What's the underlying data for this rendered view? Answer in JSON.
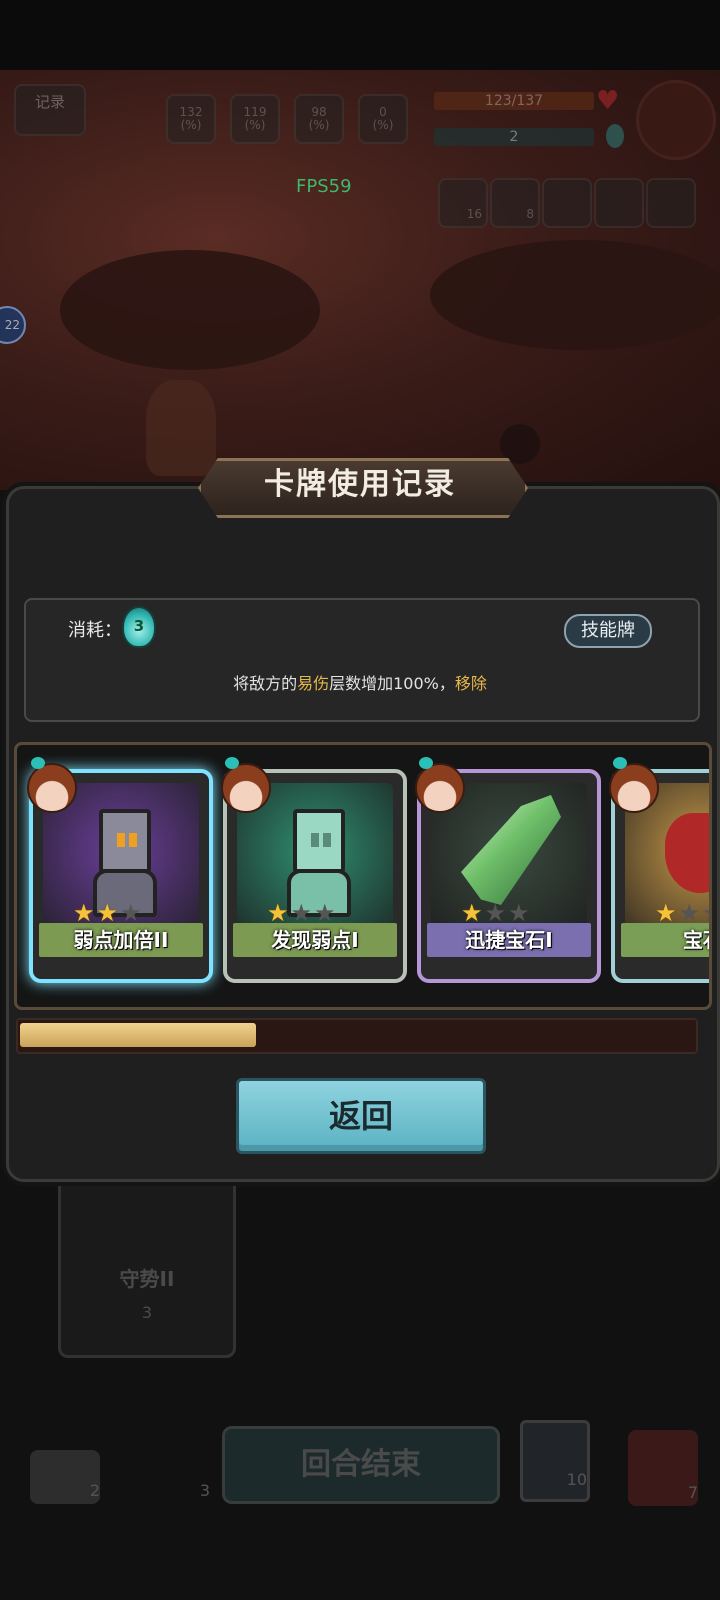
{
  "hud": {
    "record_button": "记录",
    "stats": [
      {
        "value": "132",
        "unit": "(%)"
      },
      {
        "value": "119",
        "unit": "(%)"
      },
      {
        "value": "98",
        "unit": "(%)"
      },
      {
        "value": "0",
        "unit": "(%)"
      }
    ],
    "hp": "123/137",
    "energy": "2",
    "fps": "FPS59",
    "items": [
      "16",
      "8"
    ],
    "side_badge": "22"
  },
  "dialog": {
    "title": "卡牌使用记录",
    "cost_label": "消耗：",
    "cost_value": "3",
    "tag": "技能牌",
    "desc_prefix": "将敌方的",
    "desc_highlight": "易伤",
    "desc_middle": "层数增加100%，",
    "desc_action": "移除"
  },
  "cards": [
    {
      "name": "弱点加倍II",
      "stars": 2,
      "max_stars": 3,
      "theme": "#6a3f9a",
      "frame": "#7fe3ff",
      "label_bg": "#7c9a52"
    },
    {
      "name": "发现弱点I",
      "stars": 1,
      "max_stars": 3,
      "theme": "#2f8f72",
      "frame": "#b7c1b5",
      "label_bg": "#7c9a52"
    },
    {
      "name": "迅捷宝石I",
      "stars": 1,
      "max_stars": 3,
      "theme": "#3a4a3f",
      "frame": "#b596d6",
      "label_bg": "#7b6fb0"
    },
    {
      "name": "宝石",
      "stars": 1,
      "max_stars": 3,
      "theme": "#c99a4a",
      "frame": "#a0d0d6",
      "label_bg": "#7b9e56"
    }
  ],
  "progress": {
    "value": 0.35
  },
  "back_button": "返回",
  "bottom": {
    "card_name": "守势II",
    "card_cost": "3",
    "end_turn": "回合结束",
    "draw_count": "2",
    "discard_count": "3",
    "potion_count": "10",
    "deck_count": "7"
  }
}
